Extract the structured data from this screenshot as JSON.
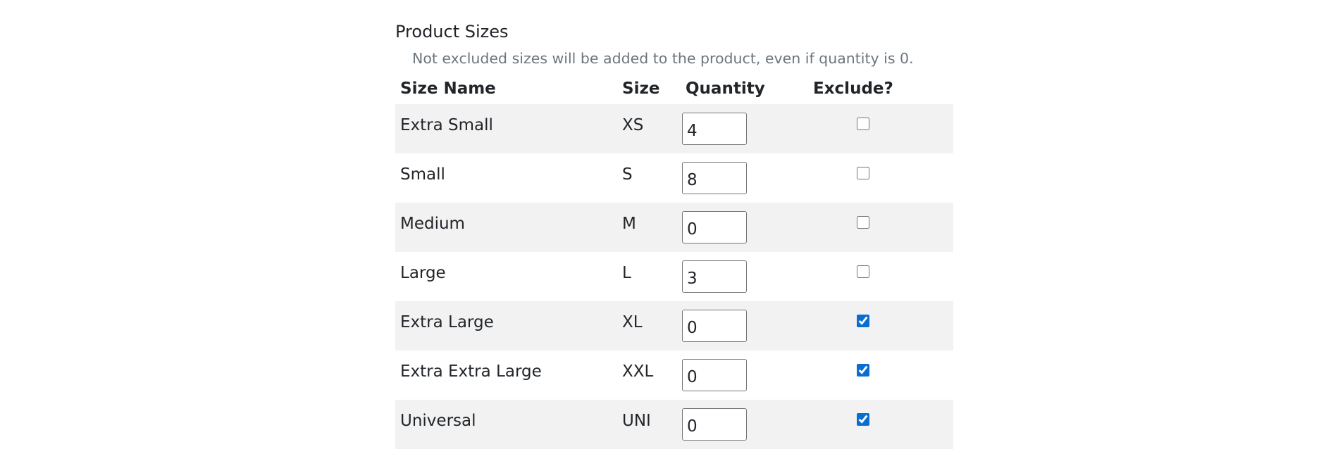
{
  "section": {
    "title": "Product Sizes",
    "hint": "Not excluded sizes will be added to the product, even if quantity is 0."
  },
  "table": {
    "headers": {
      "name": "Size Name",
      "size": "Size",
      "quantity": "Quantity",
      "exclude": "Exclude?"
    },
    "rows": [
      {
        "name": "Extra Small",
        "size": "XS",
        "quantity": "4",
        "exclude": false
      },
      {
        "name": "Small",
        "size": "S",
        "quantity": "8",
        "exclude": false
      },
      {
        "name": "Medium",
        "size": "M",
        "quantity": "0",
        "exclude": false
      },
      {
        "name": "Large",
        "size": "L",
        "quantity": "3",
        "exclude": false
      },
      {
        "name": "Extra Large",
        "size": "XL",
        "quantity": "0",
        "exclude": true
      },
      {
        "name": "Extra Extra Large",
        "size": "XXL",
        "quantity": "0",
        "exclude": true
      },
      {
        "name": "Universal",
        "size": "UNI",
        "quantity": "0",
        "exclude": true
      }
    ]
  },
  "colors": {
    "stripe": "#f2f2f2",
    "muted_text": "#6c757d",
    "checkbox_accent": "#0a6ed1"
  }
}
